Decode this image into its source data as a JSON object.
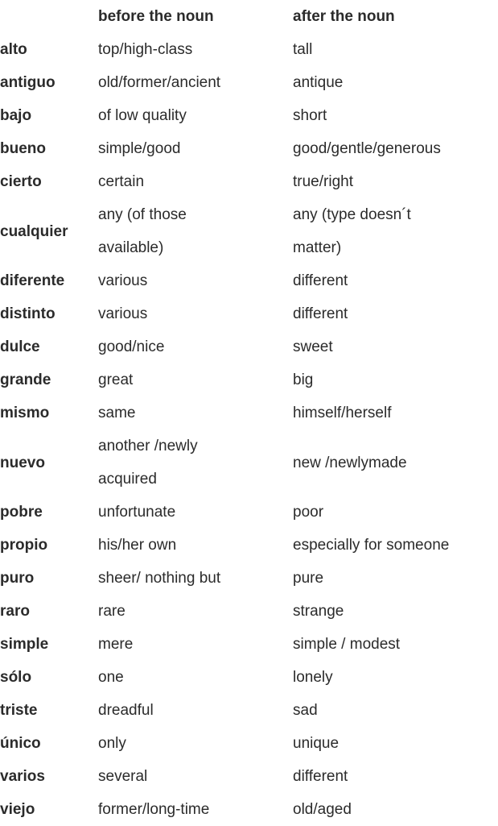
{
  "table": {
    "headers": {
      "word": "",
      "before": "before the noun",
      "after": "after the noun"
    },
    "rows": [
      {
        "word": "alto",
        "before": "top/high-class",
        "after": "tall",
        "wrap": false
      },
      {
        "word": "antiguo",
        "before": "old/former/ancient",
        "after": "antique",
        "wrap": false
      },
      {
        "word": "bajo",
        "before": "of low quality",
        "after": "short",
        "wrap": false
      },
      {
        "word": "bueno",
        "before": "simple/good",
        "after": "good/gentle/generous",
        "wrap": false
      },
      {
        "word": "cierto",
        "before": "certain",
        "after": "true/right",
        "wrap": false
      },
      {
        "word": "cualquier",
        "before": "any (of those available)",
        "after": "any (type doesn´t matter)",
        "wrap": true
      },
      {
        "word": "diferente",
        "before": "various",
        "after": "different",
        "wrap": false
      },
      {
        "word": "distinto",
        "before": "various",
        "after": "different",
        "wrap": false
      },
      {
        "word": "dulce",
        "before": "good/nice",
        "after": "sweet",
        "wrap": false
      },
      {
        "word": "grande",
        "before": "great",
        "after": "big",
        "wrap": false
      },
      {
        "word": "mismo",
        "before": "same",
        "after": "himself/herself",
        "wrap": false
      },
      {
        "word": "nuevo",
        "before": "another /newly acquired",
        "after": "new /newlymade",
        "wrap": true
      },
      {
        "word": "pobre",
        "before": "unfortunate",
        "after": "poor",
        "wrap": false
      },
      {
        "word": "propio",
        "before": "his/her own",
        "after": "especially for someone",
        "wrap": false
      },
      {
        "word": "puro",
        "before": "sheer/ nothing but",
        "after": "pure",
        "wrap": false
      },
      {
        "word": "raro",
        "before": "rare",
        "after": "strange",
        "wrap": false
      },
      {
        "word": "simple",
        "before": "mere",
        "after": "simple / modest",
        "wrap": false
      },
      {
        "word": "sólo",
        "before": "one",
        "after": "lonely",
        "wrap": false
      },
      {
        "word": "triste",
        "before": "dreadful",
        "after": "sad",
        "wrap": false
      },
      {
        "word": "único",
        "before": "only",
        "after": "unique",
        "wrap": false
      },
      {
        "word": "varios",
        "before": "several",
        "after": "different",
        "wrap": false
      },
      {
        "word": "viejo",
        "before": "former/long-time",
        "after": "old/aged",
        "wrap": false
      }
    ]
  },
  "style": {
    "text_color": "#2b2b2b",
    "background_color": "#ffffff"
  }
}
